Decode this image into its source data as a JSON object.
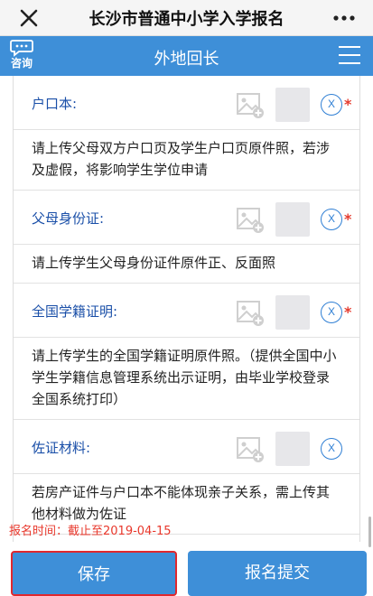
{
  "topbar": {
    "title": "长沙市普通中小学入学报名"
  },
  "header": {
    "consult_label": "咨询",
    "title": "外地回长"
  },
  "documents": [
    {
      "label": "户口本:",
      "delete_label": "X",
      "required": "*",
      "note": "请上传父母双方户口页及学生户口页原件照，若涉及虚假，将影响学生学位申请"
    },
    {
      "label": "父母身份证:",
      "delete_label": "X",
      "required": "*",
      "note": "请上传学生父母身份证件原件正、反面照"
    },
    {
      "label": "全国学籍证明:",
      "delete_label": "X",
      "required": "*",
      "note": "请上传学生的全国学籍证明原件照。（提供全国中小学生学籍信息管理系统出示证明，由毕业学校登录全国系统打印）"
    },
    {
      "label": "佐证材料:",
      "delete_label": "X",
      "required": "",
      "note": "若房产证件与户口本不能体现亲子关系，需上传其他材料做为佐证"
    }
  ],
  "deadline": "报名时间：截止至2019-04-15",
  "footer": {
    "save_label": "保存",
    "submit_label": "报名提交"
  },
  "colors": {
    "primary": "#3e8fd8",
    "label": "#1a4fa8",
    "required": "#e53b2e",
    "save_border": "#e0282e"
  }
}
